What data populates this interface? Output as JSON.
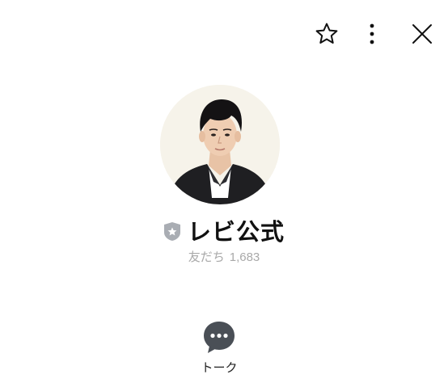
{
  "header": {
    "actions": [
      {
        "icon": "star-icon",
        "kind": "favorite"
      },
      {
        "icon": "more-vertical-icon",
        "kind": "menu"
      },
      {
        "icon": "close-icon",
        "kind": "close"
      }
    ]
  },
  "profile": {
    "name": "レビ公式",
    "badge_icon": "official-account-shield-icon",
    "friends_label": "友だち",
    "friends_count": "1,683",
    "avatar_bg": "#f5f2e8"
  },
  "actions": {
    "talk_label": "トーク",
    "talk_icon": "chat-bubble-icon"
  },
  "colors": {
    "text_primary": "#111111",
    "text_secondary": "#a9a9a9",
    "icon_dark": "#4a4f56",
    "badge_gray": "#a9adb3"
  }
}
